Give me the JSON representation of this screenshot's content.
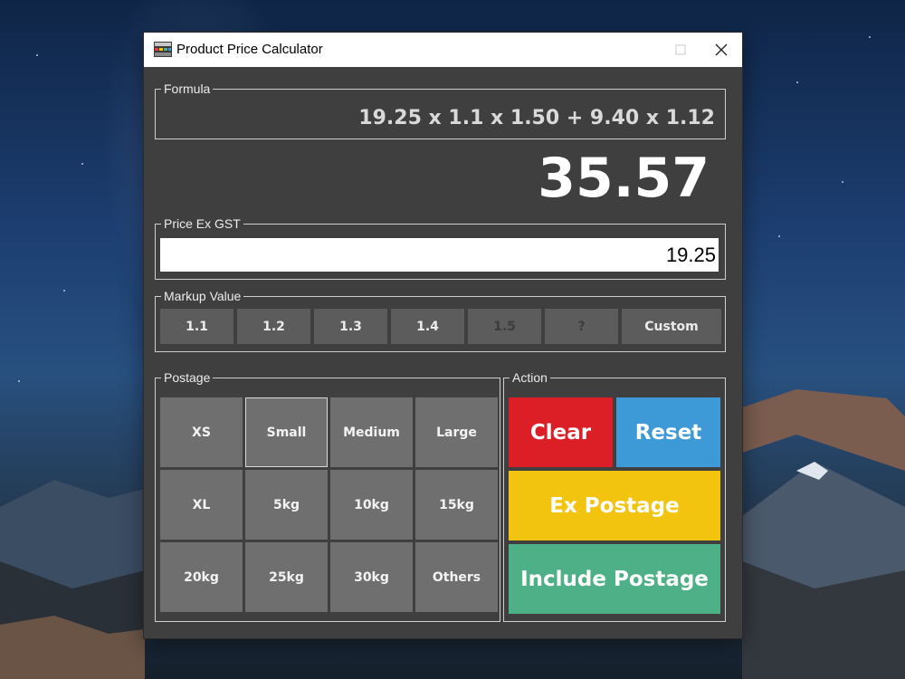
{
  "window": {
    "title": "Product Price Calculator",
    "controls": [
      "minimize-icon",
      "maximize-icon",
      "close-icon"
    ]
  },
  "formula": {
    "legend": "Formula",
    "text": "19.25 x 1.1 x 1.50 + 9.40 x 1.12"
  },
  "result": {
    "value": "35.57"
  },
  "price": {
    "legend": "Price Ex GST",
    "value": "19.25"
  },
  "markup": {
    "legend": "Markup Value",
    "buttons": [
      {
        "label": "1.1",
        "enabled": true
      },
      {
        "label": "1.2",
        "enabled": true
      },
      {
        "label": "1.3",
        "enabled": true
      },
      {
        "label": "1.4",
        "enabled": true
      },
      {
        "label": "1.5",
        "enabled": false
      },
      {
        "label": "?",
        "enabled": false
      },
      {
        "label": "Custom",
        "enabled": true
      }
    ]
  },
  "postage": {
    "legend": "Postage",
    "selected": "Small",
    "buttons": [
      "XS",
      "Small",
      "Medium",
      "Large",
      "XL",
      "5kg",
      "10kg",
      "15kg",
      "20kg",
      "25kg",
      "30kg",
      "Others"
    ]
  },
  "action": {
    "legend": "Action",
    "buttons": [
      {
        "label": "Clear",
        "color": "#dc1f26"
      },
      {
        "label": "Reset",
        "color": "#3d9ad7"
      },
      {
        "label": "Ex Postage",
        "color": "#f2c30f"
      },
      {
        "label": "Include Postage",
        "color": "#4eb087"
      }
    ]
  }
}
